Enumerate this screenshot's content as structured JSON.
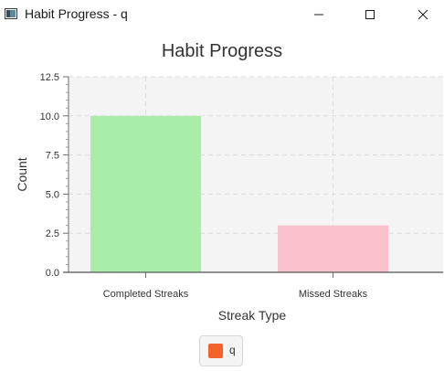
{
  "window": {
    "title": "Habit Progress - q",
    "controls": {
      "minimize": "minimize",
      "maximize": "maximize",
      "close": "close"
    }
  },
  "chart_data": {
    "type": "bar",
    "title": "Habit Progress",
    "xlabel": "Streak Type",
    "ylabel": "Count",
    "categories": [
      "Completed Streaks",
      "Missed Streaks"
    ],
    "series": [
      {
        "name": "q",
        "values": [
          10,
          3
        ]
      }
    ],
    "bar_colors": [
      "#a8eda8",
      "#f9c2cc"
    ],
    "ylim": [
      0,
      12.5
    ],
    "yticks": [
      0,
      2.5,
      5,
      7.5,
      10,
      12.5
    ],
    "ytick_labels": [
      "0.0",
      "2.5",
      "5.0",
      "7.5",
      "10.0",
      "12.5"
    ],
    "grid": true,
    "legend": {
      "position": "bottom",
      "items": [
        {
          "label": "q",
          "color": "#f3622d"
        }
      ]
    }
  },
  "colors": {
    "plot_background": "#f4f4f4",
    "grid": "#dddddd",
    "axis": "#6e6e6e",
    "text": "#333333"
  }
}
